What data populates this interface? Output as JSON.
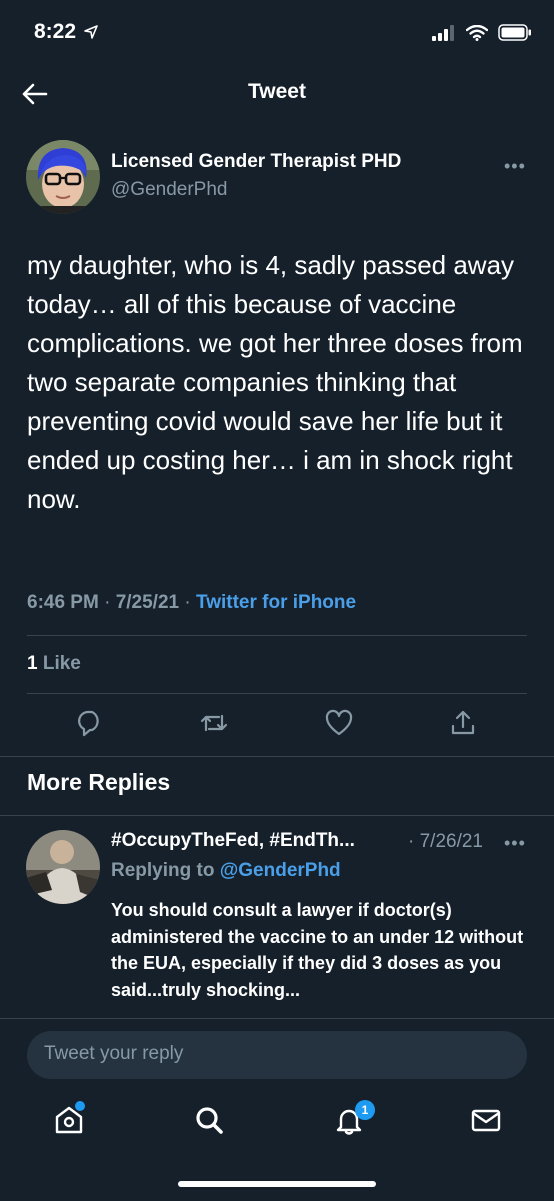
{
  "status_bar": {
    "time": "8:22"
  },
  "header": {
    "title": "Tweet"
  },
  "tweet": {
    "author_name": "Licensed Gender Therapist PHD",
    "author_handle": "@GenderPhd",
    "text": "my daughter, who is 4, sadly passed away today… all of this because of vaccine complications. we got her three doses from two separate companies thinking that preventing covid would save her life but it ended up costing her… i am in shock right now.",
    "time": "6:46 PM",
    "date": "7/25/21",
    "client": "Twitter for iPhone",
    "like_count": "1",
    "like_label": "Like"
  },
  "replies_section": {
    "title": "More Replies",
    "items": [
      {
        "name": "#OccupyTheFed, #EndTh...",
        "date": "· 7/26/21",
        "replying_prefix": "Replying to",
        "replying_handle": "@GenderPhd",
        "text": "You should consult a lawyer if doctor(s) administered the vaccine to an under 12 without the EUA, especially if they did 3 doses as you said...truly shocking..."
      }
    ]
  },
  "composer": {
    "placeholder": "Tweet your reply"
  },
  "tab_bar": {
    "notifications_badge": "1"
  },
  "icons": {
    "back": "arrow-left-icon",
    "more": "more-horizontal-icon",
    "reply": "comment-icon",
    "retweet": "retweet-icon",
    "like": "heart-icon",
    "share": "share-icon",
    "home": "home-icon",
    "search": "search-icon",
    "notifications": "bell-icon",
    "messages": "mail-icon"
  },
  "colors": {
    "background": "#15202b",
    "accent": "#1d9bf0",
    "secondary_text": "#8899a6",
    "divider": "#38444d"
  }
}
